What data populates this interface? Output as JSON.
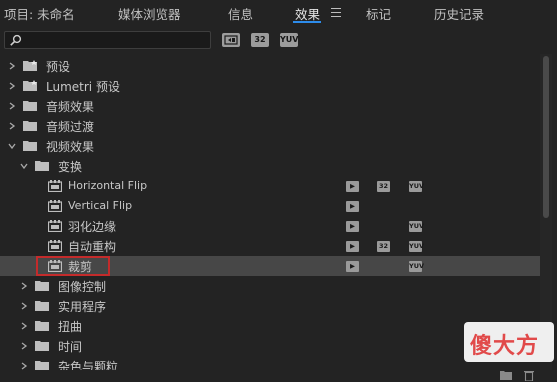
{
  "tabs": [
    {
      "label": "项目: 未命名",
      "active": false
    },
    {
      "label": "媒体浏览器",
      "active": false
    },
    {
      "label": "信息",
      "active": false
    },
    {
      "label": "效果",
      "active": true
    },
    {
      "label": "标记",
      "active": false
    },
    {
      "label": "历史记录",
      "active": false
    }
  ],
  "search": {
    "value": "",
    "icon": "search-icon"
  },
  "filters": {
    "accelerated": "GPU",
    "bit32": "32",
    "yuv": "YUV"
  },
  "tree": [
    {
      "label": "预设",
      "type": "preset-folder",
      "level": 0,
      "expanded": false
    },
    {
      "label": "Lumetri 预设",
      "type": "preset-folder",
      "level": 0,
      "expanded": false
    },
    {
      "label": "音频效果",
      "type": "folder",
      "level": 0,
      "expanded": false
    },
    {
      "label": "音频过渡",
      "type": "folder",
      "level": 0,
      "expanded": false
    },
    {
      "label": "视频效果",
      "type": "folder",
      "level": 0,
      "expanded": true
    },
    {
      "label": "变换",
      "type": "folder",
      "level": 1,
      "expanded": true
    },
    {
      "label": "Horizontal Flip",
      "type": "effect",
      "level": 2,
      "badges": [
        "acc",
        "32",
        "yuv"
      ]
    },
    {
      "label": "Vertical Flip",
      "type": "effect",
      "level": 2,
      "badges": [
        "acc"
      ]
    },
    {
      "label": "羽化边缘",
      "type": "effect",
      "level": 2,
      "badges": [
        "acc",
        "yuv"
      ]
    },
    {
      "label": "自动重构",
      "type": "effect",
      "level": 2,
      "badges": [
        "acc",
        "32",
        "yuv"
      ]
    },
    {
      "label": "裁剪",
      "type": "effect",
      "level": 2,
      "badges": [
        "acc",
        "yuv"
      ],
      "selected": true
    },
    {
      "label": "图像控制",
      "type": "folder",
      "level": 1,
      "expanded": false
    },
    {
      "label": "实用程序",
      "type": "folder",
      "level": 1,
      "expanded": false
    },
    {
      "label": "扭曲",
      "type": "folder",
      "level": 1,
      "expanded": false
    },
    {
      "label": "时间",
      "type": "folder",
      "level": 1,
      "expanded": false
    },
    {
      "label": "杂色与颗粒",
      "type": "folder",
      "level": 1,
      "expanded": false
    }
  ],
  "watermark": {
    "text": "傻大方"
  },
  "colors": {
    "accent": "#2d8ceb",
    "selected_row": "#474747",
    "highlight_border": "#c42b2b",
    "background": "#232323"
  }
}
